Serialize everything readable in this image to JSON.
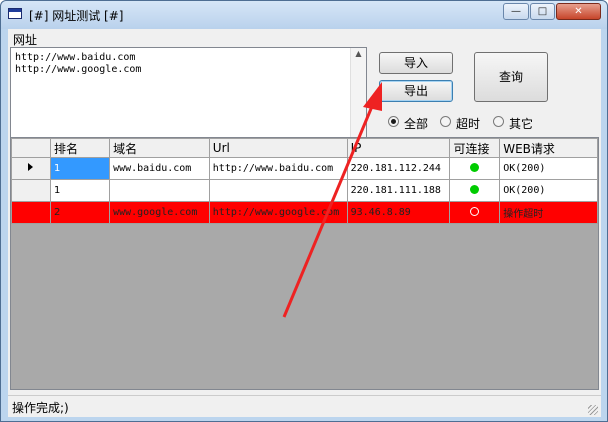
{
  "window": {
    "title": "[#] 网址测试 [#]",
    "controls": {
      "minimize": "—",
      "maximize": "□",
      "close": "✕"
    }
  },
  "url_group": {
    "label": "网址",
    "urls_text": "http://www.baidu.com\nhttp://www.google.com"
  },
  "buttons": {
    "import": "导入",
    "export": "导出",
    "query": "查询"
  },
  "filters": [
    {
      "label": "全部",
      "selected": true
    },
    {
      "label": "超时",
      "selected": false
    },
    {
      "label": "其它",
      "selected": false
    }
  ],
  "grid": {
    "columns": [
      "排名",
      "域名",
      "Url",
      "IP",
      "可连接",
      "WEB请求"
    ],
    "rows": [
      {
        "rank": "1",
        "domain": "www.baidu.com",
        "url": "http://www.baidu.com",
        "ip": "220.181.112.244",
        "reachable": "green",
        "web": "OK(200)"
      },
      {
        "rank": "1",
        "domain": "",
        "url": "",
        "ip": "220.181.111.188",
        "reachable": "green",
        "web": "OK(200)"
      },
      {
        "rank": "2",
        "domain": "www.google.com",
        "url": "http://www.google.com",
        "ip": "93.46.8.89",
        "reachable": "none",
        "web": "操作超时"
      }
    ]
  },
  "status": {
    "text": "操作完成;)"
  },
  "colors": {
    "error_row": "#ff0000",
    "selected_cell": "#3399ff",
    "ok_dot": "#00cc00",
    "arrow": "#ee2222"
  }
}
